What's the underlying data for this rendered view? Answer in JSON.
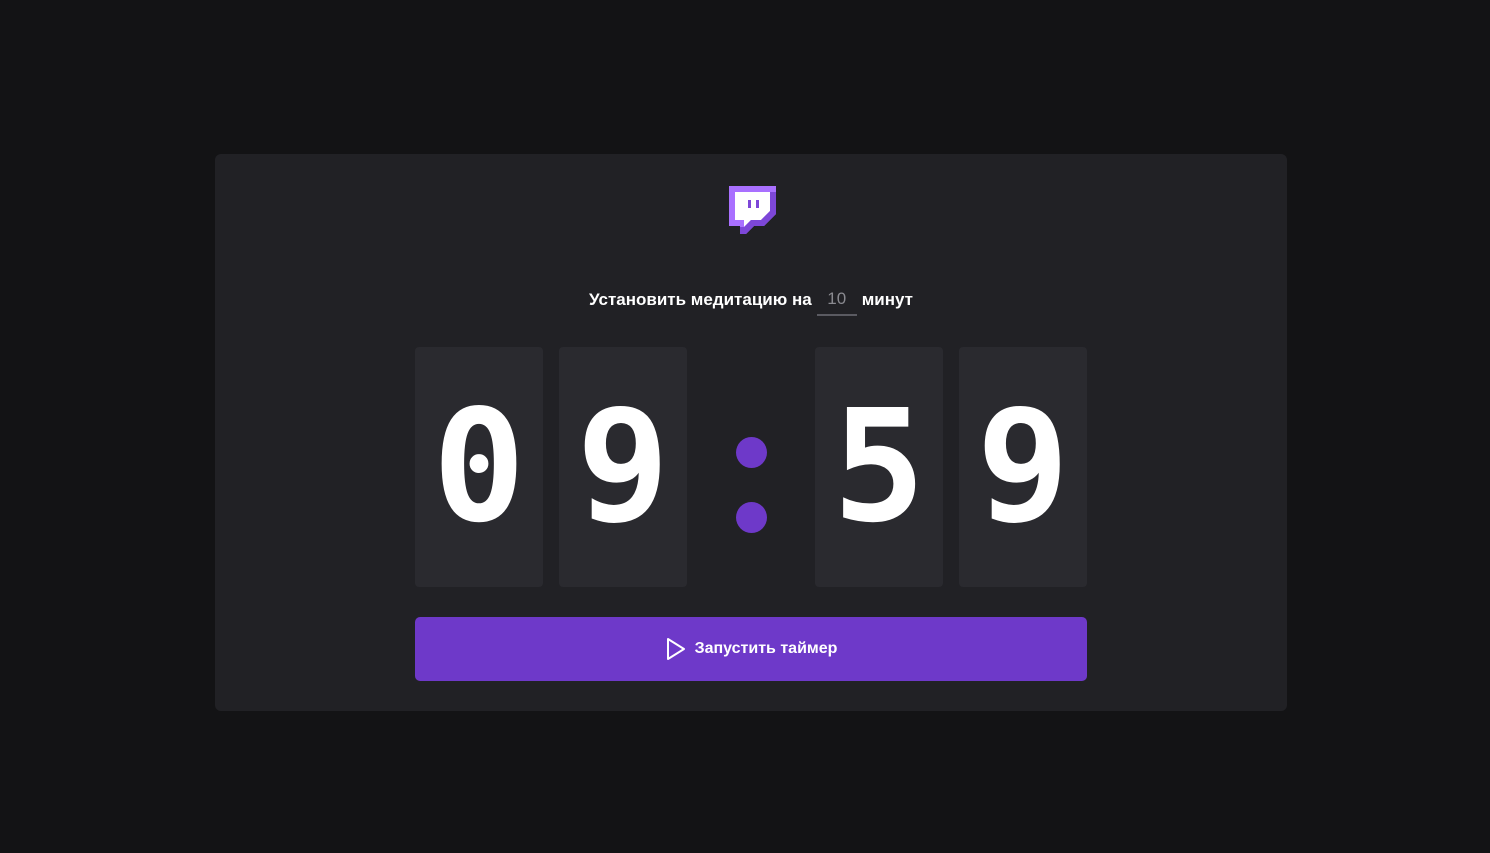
{
  "setup": {
    "prefix": "Установить медитацию на",
    "minutes_value": "",
    "minutes_placeholder": "10",
    "suffix": "минут"
  },
  "timer": {
    "minute_tens": "0",
    "minute_ones": "9",
    "second_tens": "5",
    "second_ones": "9"
  },
  "start_button": {
    "label": "Запустить таймер",
    "icon": "play-icon"
  },
  "logo": {
    "icon": "twitch-logo-icon"
  },
  "colors": {
    "page_background": "#131315",
    "card_background": "#212125",
    "digit_background": "#2a2a2f",
    "accent": "#6e39c9",
    "text": "#ffffff",
    "muted_text": "#8a8a90"
  }
}
